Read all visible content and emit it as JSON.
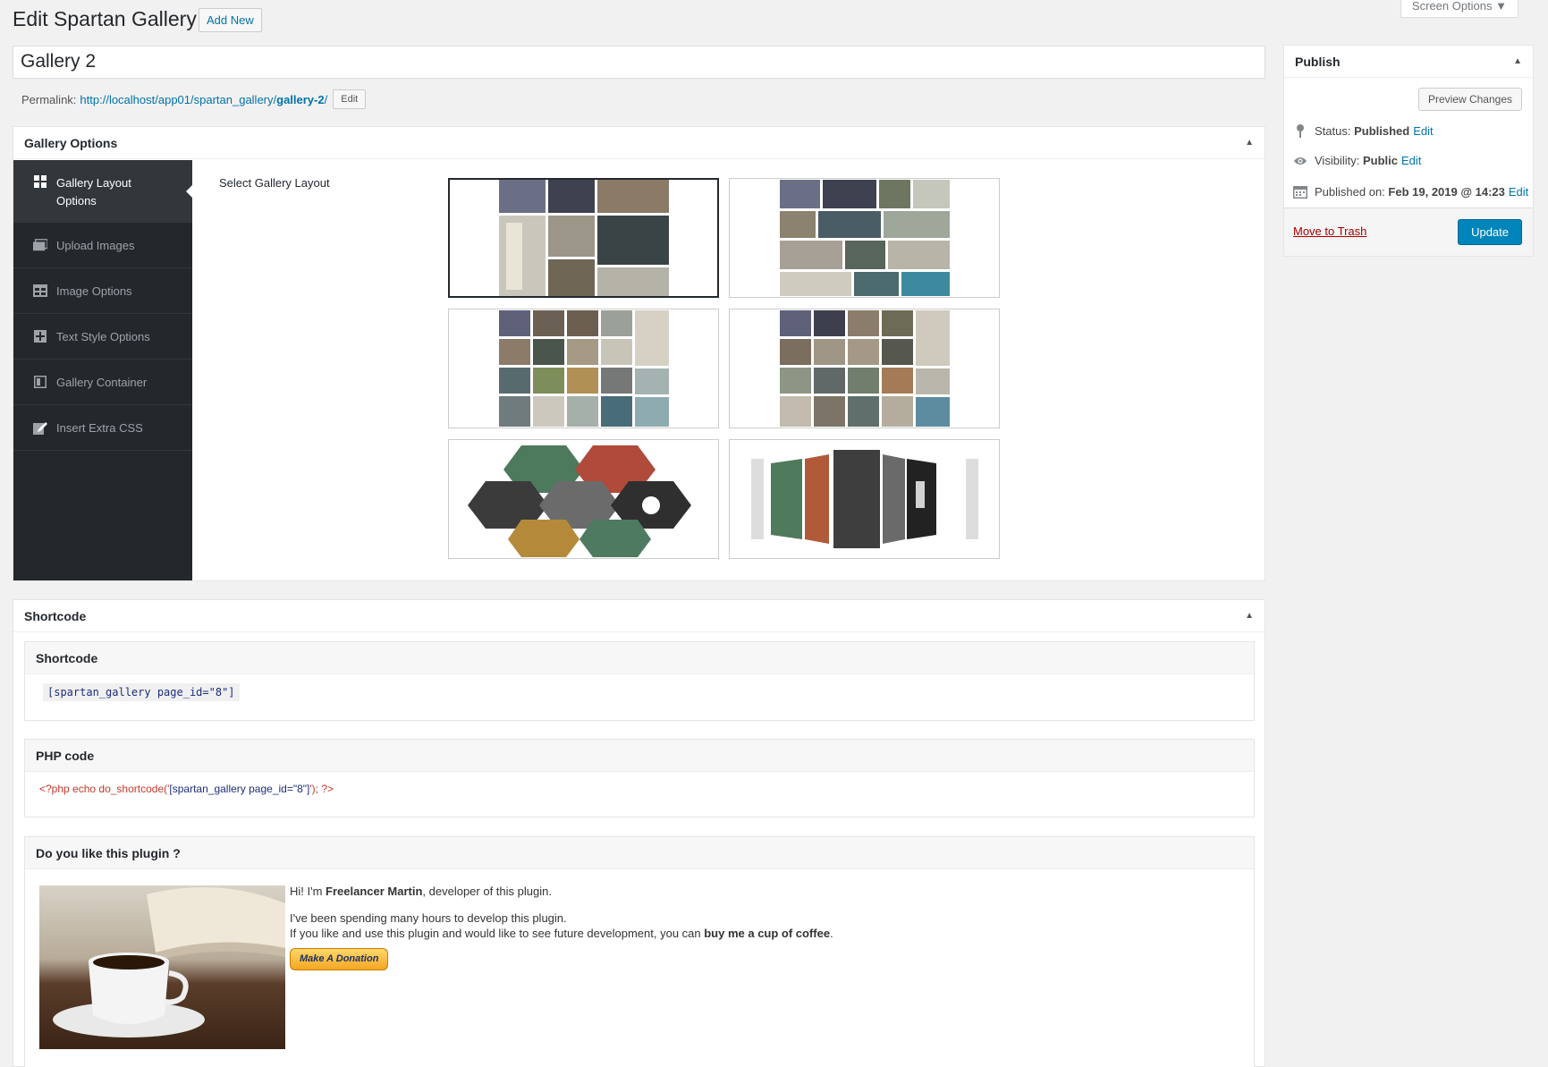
{
  "header": {
    "title": "Edit Spartan Gallery",
    "add_new": "Add New",
    "screen_options": "Screen Options ▼"
  },
  "post": {
    "title": "Gallery 2",
    "permalink_label": "Permalink:",
    "permalink_base": "http://localhost/app01/spartan_gallery/",
    "permalink_slug": "gallery-2",
    "permalink_trail": "/",
    "edit_label": "Edit"
  },
  "gallery_options": {
    "title": "Gallery Options",
    "tabs": [
      {
        "label": "Gallery Layout Options",
        "icon": "grid-icon",
        "active": true
      },
      {
        "label": "Upload Images",
        "icon": "images-icon"
      },
      {
        "label": "Image Options",
        "icon": "table-icon"
      },
      {
        "label": "Text Style Options",
        "icon": "text-icon"
      },
      {
        "label": "Gallery Container",
        "icon": "container-icon"
      },
      {
        "label": "Insert Extra CSS",
        "icon": "edit-icon"
      }
    ],
    "select_label": "Select Gallery Layout",
    "layouts": [
      "masonry",
      "mosaic",
      "grid",
      "grid-2",
      "hexagon",
      "3d-carousel"
    ],
    "selected_layout": 0
  },
  "shortcode": {
    "title": "Shortcode",
    "shortcode_head": "Shortcode",
    "shortcode_value": "[spartan_gallery page_id=\"8\"]",
    "php_head": "PHP code",
    "php_prefix": "<?php echo do_shortcode('",
    "php_string": "[spartan_gallery page_id=\"8\"]",
    "php_suffix": "'); ?>",
    "like_head": "Do you like this plugin ?",
    "hi_prefix": "Hi! I'm ",
    "author": "Freelancer Martin",
    "hi_suffix": ", developer of this plugin.",
    "line2": "I've been spending many hours to develop this plugin.",
    "line3_prefix": "If you like and use this plugin and would like to see future development, you can ",
    "line3_bold": "buy me a cup of coffee",
    "line3_suffix": ".",
    "donate": "Make A Donation"
  },
  "publish": {
    "title": "Publish",
    "preview": "Preview Changes",
    "status_label": "Status: ",
    "status_value": "Published",
    "visibility_label": "Visibility: ",
    "visibility_value": "Public",
    "published_label": "Published on: ",
    "published_value": "Feb 19, 2019 @ 14:23",
    "edit": "Edit",
    "trash": "Move to Trash",
    "update": "Update"
  },
  "colors": {
    "accent": "#0085ba",
    "sidebar": "#23282d",
    "link": "#0073aa",
    "trash": "#a00"
  }
}
